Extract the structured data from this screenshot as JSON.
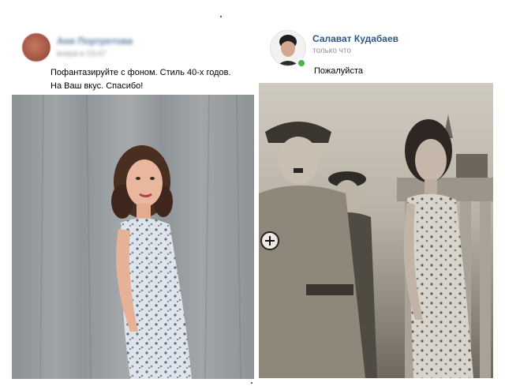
{
  "left_post": {
    "author": "Аня Портретова",
    "time": "вчера в 23:47",
    "lines": [
      "Пофантазируйте с фоном. Стиль 40-х годов.",
      "На Ваш вкус. Спасибо!"
    ],
    "photo": "woman-in-floral-dress-photo"
  },
  "right_post": {
    "author": "Салават Кудабаев",
    "time": "только что",
    "text": "Пожалуйста",
    "photo": "edited-1940s-scene-photo",
    "online_color": "#4bb34b"
  }
}
